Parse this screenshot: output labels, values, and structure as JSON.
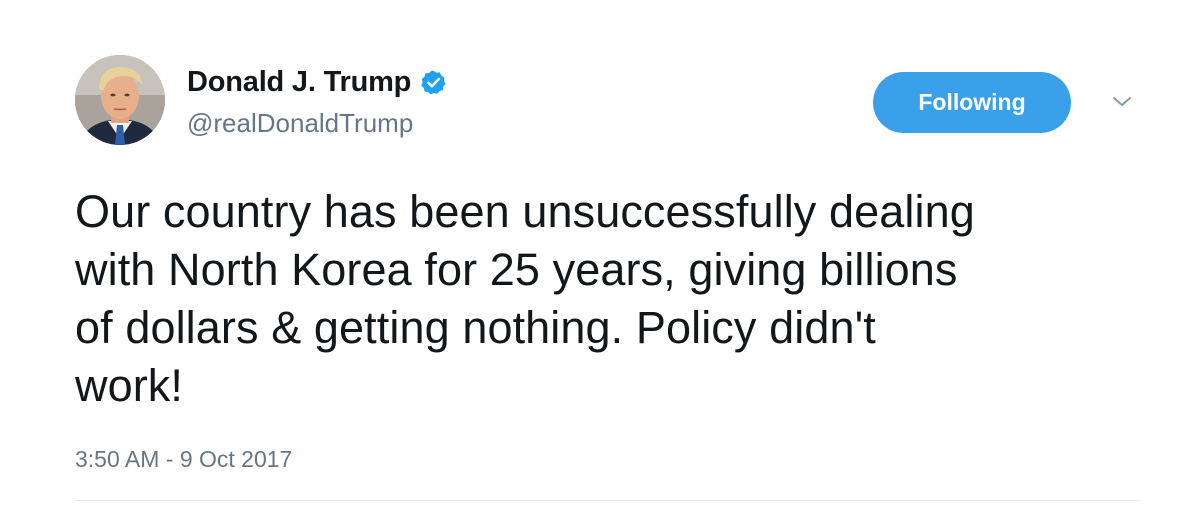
{
  "author": {
    "display_name": "Donald J. Trump",
    "handle": "@realDonaldTrump",
    "verified": true
  },
  "follow_button": {
    "label": "Following"
  },
  "menu": {
    "icon": "chevron-down-icon"
  },
  "tweet": {
    "text": "Our country has been unsuccessfully dealing\nwith North Korea for 25 years, giving billions\nof dollars & getting nothing. Policy didn't\nwork!",
    "timestamp": "3:50 AM - 9 Oct 2017"
  },
  "colors": {
    "accent": "#3aa0ea",
    "verified_badge": "#1da1f2",
    "secondary_text": "#657786",
    "primary_text": "#14171a",
    "divider": "#e6ecf0"
  }
}
